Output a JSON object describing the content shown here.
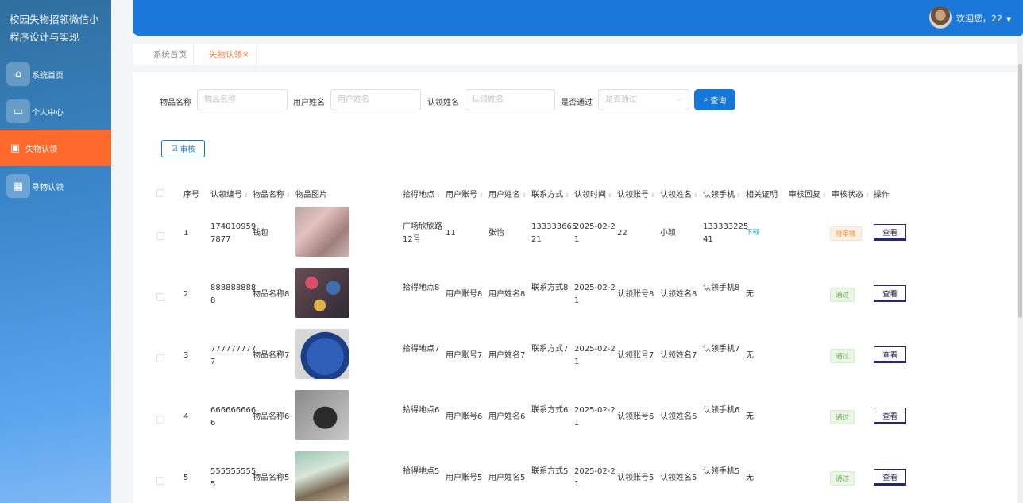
{
  "app": {
    "title_line1": "校园失物招领微信小",
    "title_line2": "程序设计与实现"
  },
  "sidebar": {
    "items": [
      {
        "label": "系统首页",
        "icon": "home-icon"
      },
      {
        "label": "个人中心",
        "icon": "profile-icon"
      },
      {
        "label": "失物认领",
        "icon": "briefcase-icon",
        "active": true
      },
      {
        "label": "寻物认领",
        "icon": "grid-icon"
      }
    ]
  },
  "header": {
    "welcome": "欢迎您，22",
    "dropdown": "▼"
  },
  "tabs": [
    {
      "label": "系统首页"
    },
    {
      "label": "失物认领",
      "close": "×"
    }
  ],
  "search": {
    "item_name_label": "物品名称",
    "item_name_placeholder": "物品名称",
    "user_name_label": "用户姓名",
    "user_name_placeholder": "用户姓名",
    "claimer_name_label": "认领姓名",
    "claimer_name_placeholder": "认领姓名",
    "passed_label": "是否通过",
    "passed_placeholder": "是否通过",
    "query_button": "查询"
  },
  "toolbar": {
    "audit_button": "审核"
  },
  "table": {
    "headers": [
      "序号",
      "认领编号",
      "物品名称",
      "物品图片",
      "拾得地点",
      "用户账号",
      "用户姓名",
      "联系方式",
      "认领时间",
      "认领账号",
      "认领姓名",
      "认领手机",
      "相关证明",
      "审核回复",
      "审核状态",
      "操作"
    ],
    "rows": [
      {
        "idx": "1",
        "no_l1": "17401095​9",
        "no_l2": "7877",
        "name": "钱包",
        "place_l1": "广场欣欣路",
        "place_l2": "12号",
        "account": "11",
        "uname": "张怡",
        "contact_l1": "13333366​5",
        "contact_l2": "21",
        "time_l1": "2025-02-2",
        "time_l2": "1",
        "c_account": "22",
        "c_name": "小颖",
        "c_phone_l1": "13333322​5",
        "c_phone_l2": "41",
        "proof": "下载",
        "status": "待审核",
        "action": "查看"
      },
      {
        "idx": "2",
        "no_l1": "888888888",
        "no_l2": "8",
        "name": "物品名称8",
        "place_l1": "拾得地点8",
        "place_l2": "",
        "account": "用户账号8",
        "uname": "用户姓名8",
        "contact_l1": "联系方式8",
        "contact_l2": "",
        "time_l1": "2025-02-2",
        "time_l2": "1",
        "c_account": "认领账号8",
        "c_name": "认领姓名8",
        "c_phone_l1": "认领手机8",
        "c_phone_l2": "",
        "proof": "无",
        "status": "通过",
        "action": "查看"
      },
      {
        "idx": "3",
        "no_l1": "777777777",
        "no_l2": "7",
        "name": "物品名称7",
        "place_l1": "拾得地点7",
        "place_l2": "",
        "account": "用户账号7",
        "uname": "用户姓名7",
        "contact_l1": "联系方式7",
        "contact_l2": "",
        "time_l1": "2025-02-2",
        "time_l2": "1",
        "c_account": "认领账号7",
        "c_name": "认领姓名7",
        "c_phone_l1": "认领手机7",
        "c_phone_l2": "",
        "proof": "无",
        "status": "通过",
        "action": "查看"
      },
      {
        "idx": "4",
        "no_l1": "666666666",
        "no_l2": "6",
        "name": "物品名称6",
        "place_l1": "拾得地点6",
        "place_l2": "",
        "account": "用户账号6",
        "uname": "用户姓名6",
        "contact_l1": "联系方式6",
        "contact_l2": "",
        "time_l1": "2025-02-2",
        "time_l2": "1",
        "c_account": "认领账号6",
        "c_name": "认领姓名6",
        "c_phone_l1": "认领手机6",
        "c_phone_l2": "",
        "proof": "无",
        "status": "通过",
        "action": "查看"
      },
      {
        "idx": "5",
        "no_l1": "555555555",
        "no_l2": "5",
        "name": "物品名称5",
        "place_l1": "拾得地点5",
        "place_l2": "",
        "account": "用户账号5",
        "uname": "用户姓名5",
        "contact_l1": "联系方式5",
        "contact_l2": "",
        "time_l1": "2025-02-2",
        "time_l2": "1",
        "c_account": "认领账号5",
        "c_name": "认领姓名5",
        "c_phone_l1": "认领手机5",
        "c_phone_l2": "",
        "proof": "无",
        "status": "通过",
        "action": "查看"
      }
    ]
  }
}
